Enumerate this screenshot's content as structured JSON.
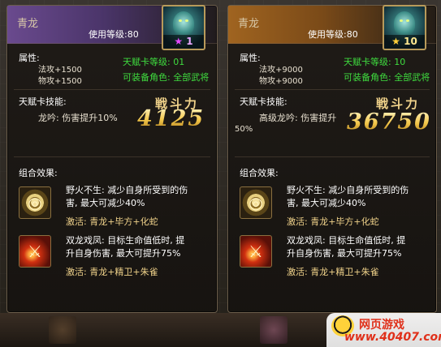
{
  "cards": [
    {
      "name": "青龙",
      "level_text": "使用等级:80",
      "star_count": "1",
      "attr_label": "属性:",
      "attr_1": "法攻+1500",
      "attr_2": "物攻+1500",
      "talent_level": "天赋卡等级: 01",
      "equip_role": "可装备角色: 全部武将",
      "talent_skill_label": "天赋卡技能:",
      "talent_skill_text": "龙吟: 伤害提升10%",
      "power_title": "戦斗力",
      "power_value": "4125",
      "combo_label": "组合效果:",
      "skills": [
        {
          "desc_1": "野火不生: 减少自身所受到的伤",
          "desc_2": "害, 最大可减少40%",
          "activate": "激活: 青龙+毕方+化蛇"
        },
        {
          "desc_1": "双龙戏凤: 目标生命值低时, 提",
          "desc_2": "升自身伤害, 最大可提升75%",
          "activate": "激活: 青龙+精卫+朱雀"
        }
      ]
    },
    {
      "name": "青龙",
      "level_text": "使用等级:80",
      "star_count": "10",
      "attr_label": "属性:",
      "attr_1": "法攻+9000",
      "attr_2": "物攻+9000",
      "talent_level": "天赋卡等级: 10",
      "equip_role": "可装备角色: 全部武将",
      "talent_skill_label": "天赋卡技能:",
      "talent_skill_text": "高级龙吟: 伤害提升",
      "talent_skill_text_2": "50%",
      "power_title": "戦斗力",
      "power_value": "36750",
      "combo_label": "组合效果:",
      "skills": [
        {
          "desc_1": "野火不生: 减少自身所受到的伤",
          "desc_2": "害, 最大可减少40%",
          "activate": "激活: 青龙+毕方+化蛇"
        },
        {
          "desc_1": "双龙戏凤: 目标生命值低时, 提",
          "desc_2": "升自身伤害, 最大可提升75%",
          "activate": "激活: 青龙+精卫+朱雀"
        }
      ]
    }
  ],
  "icons": {
    "star": "star-icon",
    "skill_1": "shield-ring-icon",
    "skill_2": "flame-blade-icon",
    "portrait": "dragon-portrait"
  },
  "watermark": {
    "top": "网页游戏",
    "url": "www.40407.com"
  },
  "colors": {
    "rare_purple": "#6a4a8e",
    "rare_gold": "#a06420",
    "talent_green": "#3fdc3f",
    "power_gold": "#f3c648"
  }
}
